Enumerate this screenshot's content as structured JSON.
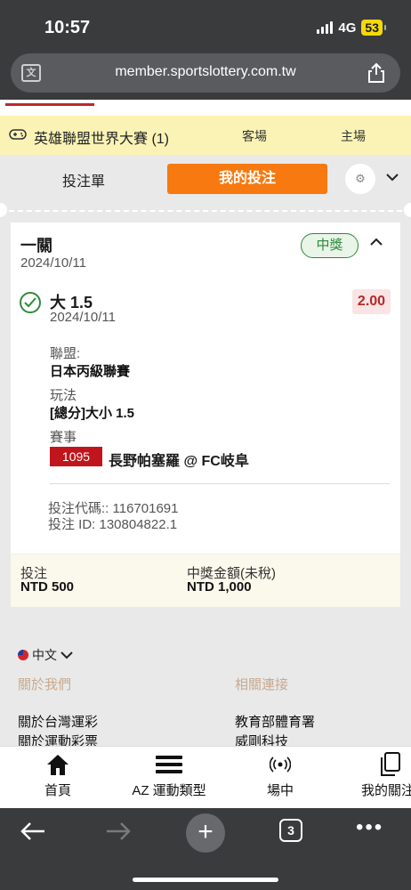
{
  "status_bar": {
    "time": "10:57",
    "network": "4G",
    "battery": "53"
  },
  "browser": {
    "url": "member.sportslottery.com.tw",
    "translate_icon": "translate-icon",
    "share_icon": "share-icon",
    "open_tabs": "3"
  },
  "event_bar": {
    "title": "英雄聯盟世界大賽 (1)",
    "away_label": "客場",
    "home_label": "主場"
  },
  "tabs": {
    "bet_slip": "投注單",
    "my_bets": "我的投注"
  },
  "bet": {
    "type": "一關",
    "date": "2024/10/11",
    "status": "中獎",
    "selection": "大 1.5",
    "selection_date": "2024/10/11",
    "odds": "2.00",
    "league_label": "聯盟:",
    "league": "日本丙級聯賽",
    "market_label": "玩法",
    "market": "[總分]大小 1.5",
    "match_label": "賽事",
    "match_id": "1095",
    "match_name": "長野帕塞羅 @ FC岐阜",
    "bet_code": "投注代碼:: 116701691",
    "bet_id": "投注 ID: 130804822.1",
    "stake_label": "投注",
    "stake": "NTD 500",
    "payout_label": "中獎金額(未稅)",
    "payout": "NTD 1,000"
  },
  "footer": {
    "language": "中文",
    "about_heading": "關於我們",
    "links_heading": "相關連接",
    "about_links": [
      "關於台灣運彩",
      "關於運動彩票"
    ],
    "related_links": [
      "教育部體育署",
      "威剛科技"
    ]
  },
  "bottom_nav": [
    {
      "label": "首頁",
      "icon": "home-icon"
    },
    {
      "label": "AZ 運動類型",
      "icon": "menu-icon"
    },
    {
      "label": "場中",
      "icon": "live-icon"
    },
    {
      "label": "我的關注",
      "icon": "copy-icon"
    }
  ],
  "colors": {
    "accent": "#f7790f",
    "win_green": "#2f8a3a",
    "odds_red": "#b32b2b",
    "event_bar": "#fbf3b5"
  }
}
